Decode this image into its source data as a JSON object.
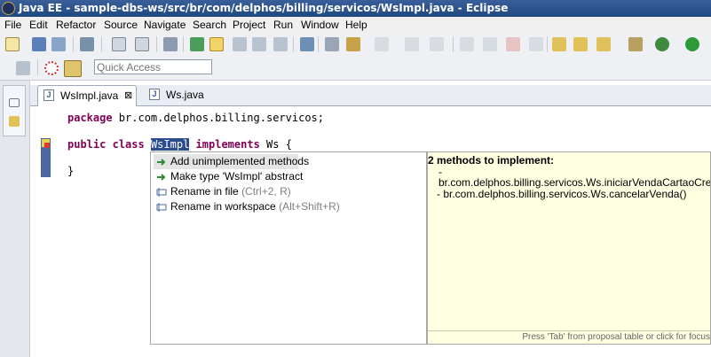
{
  "window": {
    "title": "Java EE - sample-dbs-ws/src/br/com/delphos/billing/servicos/WsImpl.java - Eclipse"
  },
  "menu": [
    "File",
    "Edit",
    "Refactor",
    "Source",
    "Navigate",
    "Search",
    "Project",
    "Run",
    "Window",
    "Help"
  ],
  "toolbar": {
    "quick_access_placeholder": "Quick Access"
  },
  "tabs": [
    {
      "label": "WsImpl.java",
      "close": "⊠"
    },
    {
      "label": "Ws.java"
    }
  ],
  "code": {
    "line1_kw": "package",
    "line1_rest": " br.com.delphos.billing.servicos;",
    "line2_kw1": "public",
    "line2_kw2": "class",
    "line2_selected": "WsImpl",
    "line2_kw3": "implements",
    "line2_rest": " Ws {",
    "line3": "}"
  },
  "proposals": [
    {
      "label": "Add unimplemented methods",
      "shortcut": ""
    },
    {
      "label": "Make type 'WsImpl' abstract",
      "shortcut": ""
    },
    {
      "label": "Rename in file",
      "shortcut": "(Ctrl+2, R)"
    },
    {
      "label": "Rename in workspace",
      "shortcut": "(Alt+Shift+R)"
    }
  ],
  "info": {
    "heading": "2 methods to implement:",
    "dash": "-",
    "method1": "br.com.delphos.billing.servicos.Ws.iniciarVendaCartaoCredito(",
    "method2": "- br.com.delphos.billing.servicos.Ws.cancelarVenda()",
    "status": "Press 'Tab' from proposal table or click for focus"
  },
  "colors": {
    "keyword": "#7f0055",
    "selection": "#2b4c8f",
    "info_bg": "#ffffe1"
  }
}
